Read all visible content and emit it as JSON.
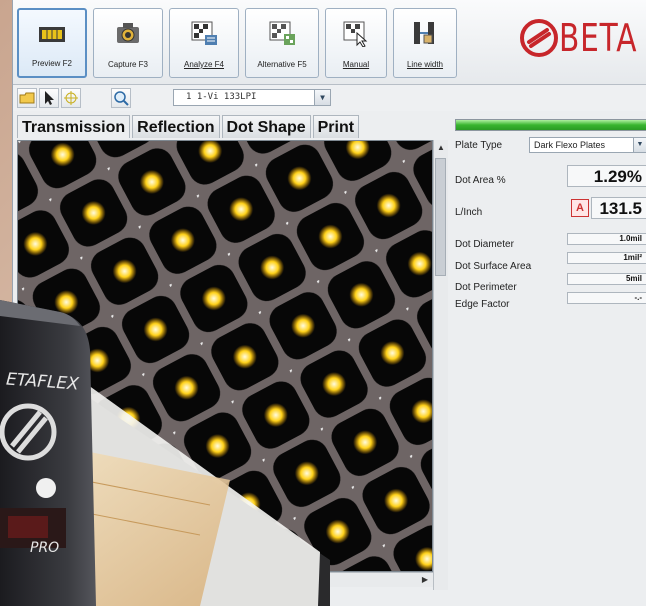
{
  "toolbar": {
    "buttons": [
      {
        "label": "Preview F2",
        "icon": "preview-icon"
      },
      {
        "label": "Capture F3",
        "icon": "camera-icon"
      },
      {
        "label": "Analyze F4",
        "icon": "analyze-icon"
      },
      {
        "label": "Alternative F5",
        "icon": "alternative-icon"
      },
      {
        "label": "Manual",
        "icon": "manual-icon"
      },
      {
        "label": "Line width",
        "icon": "line-width-icon"
      }
    ],
    "active_button": "Preview F2"
  },
  "brand": {
    "text": "BETA",
    "color": "#c7262b"
  },
  "subbar": {
    "select_value": "1  1-Vi 133LPI",
    "icons": [
      "open-folder-icon",
      "cursor-icon",
      "crosshair-icon",
      "zoom-icon"
    ]
  },
  "tabs": [
    "Transmission",
    "Reflection",
    "Dot Shape",
    "Print"
  ],
  "active_tab": "Transmission",
  "panel": {
    "progress_fraction": 1.0,
    "plate_type_label": "Plate Type",
    "plate_type_value": "Dark Flexo Plates",
    "dot_area_label": "Dot Area %",
    "dot_area_value": "1.29%",
    "lpi_label": "L/Inch",
    "lpi_badge": "A",
    "lpi_value": "131.5",
    "dot_diameter_label": "Dot Diameter",
    "dot_diameter_value": "1.0mil",
    "dot_surface_label": "Dot Surface Area",
    "dot_surface_value": "1mil²",
    "dot_perimeter_label": "Dot Perimeter",
    "dot_perimeter_value": "5mil",
    "edge_factor_label": "Edge Factor",
    "edge_factor_value": "-.-"
  },
  "device": {
    "label": "ETAFLEX",
    "badge": "PRO"
  },
  "colors": {
    "accent": "#5b8fc4",
    "dot": "#ffd21a",
    "progress": "#38b52f"
  }
}
